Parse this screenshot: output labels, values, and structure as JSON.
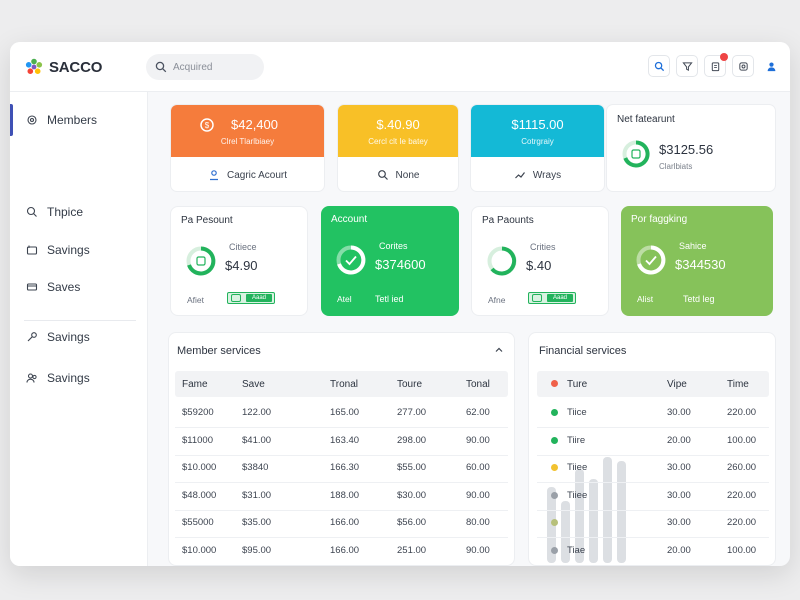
{
  "app": {
    "name": "SACCO"
  },
  "search": {
    "placeholder": "Acquired"
  },
  "sidebar": {
    "items": [
      {
        "label": "Members",
        "icon": "gear-icon"
      },
      {
        "label": "Thpice",
        "icon": "search-icon"
      },
      {
        "label": "Savings",
        "icon": "wallet-icon"
      },
      {
        "label": "Saves",
        "icon": "card-icon"
      },
      {
        "label": "Savings",
        "icon": "key-icon"
      },
      {
        "label": "Savings",
        "icon": "users-icon"
      }
    ]
  },
  "tiles": [
    {
      "amount": "$42,400",
      "sub": "Clrel     Tlarlbiaey",
      "footer": "Cagric Acourt",
      "color": "#f57c3c",
      "icon": "user-icon"
    },
    {
      "amount": "$.40.90",
      "sub": "Cercl clt Ie batey",
      "footer": "None",
      "color": "#f8c027",
      "icon": "search-icon"
    },
    {
      "amount": "$1115.00",
      "sub": "Cotrgraiy",
      "footer": "Wrays",
      "color": "#14b9d6",
      "icon": "chart-icon"
    }
  ],
  "net_card": {
    "title": "Net fatearunt",
    "amount": "$3125.56",
    "sub": "Clarlbiats"
  },
  "mid_cards": [
    {
      "title": "Pa Pesount",
      "label": "Citiece",
      "value": "$4.90",
      "foot_left": "Afiet",
      "pill": "Aaad",
      "solid": false,
      "color": "#ffffff"
    },
    {
      "title": "Account",
      "label": "Corites",
      "value": "$374600",
      "foot_left": "Atel",
      "foot_right": "Tetl ied",
      "solid": true,
      "color": "#22c262"
    },
    {
      "title": "Pa Paounts",
      "label": "Crities",
      "value": "$.40",
      "foot_left": "Afne",
      "pill": "Aaad",
      "solid": false,
      "color": "#ffffff"
    },
    {
      "title": "Por faggking",
      "label": "Sahice",
      "value": "$344530",
      "foot_left": "Alist",
      "foot_right": "Tetd leg",
      "solid": true,
      "color": "#86c25a"
    }
  ],
  "member_services": {
    "title": "Member services",
    "columns": [
      "Fame",
      "Save",
      "Tronal",
      "Toure",
      "Tonal"
    ],
    "rows": [
      [
        "$59200",
        "122.00",
        "165.00",
        "277.00",
        "62.00"
      ],
      [
        "$11000",
        "$41.00",
        "163.40",
        "298.00",
        "90.00"
      ],
      [
        "$10.000",
        "$3840",
        "166.30",
        "$55.00",
        "60.00"
      ],
      [
        "$48.000",
        "$31.00",
        "188.00",
        "$30.00",
        "90.00"
      ],
      [
        "$55000",
        "$35.00",
        "166.00",
        "$56.00",
        "80.00"
      ],
      [
        "$10.000",
        "$95.00",
        "166.00",
        "251.00",
        "90.00"
      ]
    ]
  },
  "financial_services": {
    "title": "Financial services",
    "columns": [
      "Ture",
      "Vipe",
      "Time"
    ],
    "rows": [
      {
        "name": "Tiice",
        "a": "30.00",
        "b": "220.00",
        "dot": "#22b35c"
      },
      {
        "name": "Tiire",
        "a": "20.00",
        "b": "100.00",
        "dot": "#22b35c"
      },
      {
        "name": "Tiiee",
        "a": "30.00",
        "b": "260.00",
        "dot": "#f2c230"
      },
      {
        "name": "Tiiee",
        "a": "30.00",
        "b": "220.00",
        "dot": "#9aa0a8"
      },
      {
        "name": "",
        "a": "30.00",
        "b": "220.00",
        "dot": "#b7c07a"
      },
      {
        "name": "Tiae",
        "a": "20.00",
        "b": "100.00",
        "dot": "#9aa0a8"
      }
    ],
    "header_dot": "#f0614a"
  }
}
